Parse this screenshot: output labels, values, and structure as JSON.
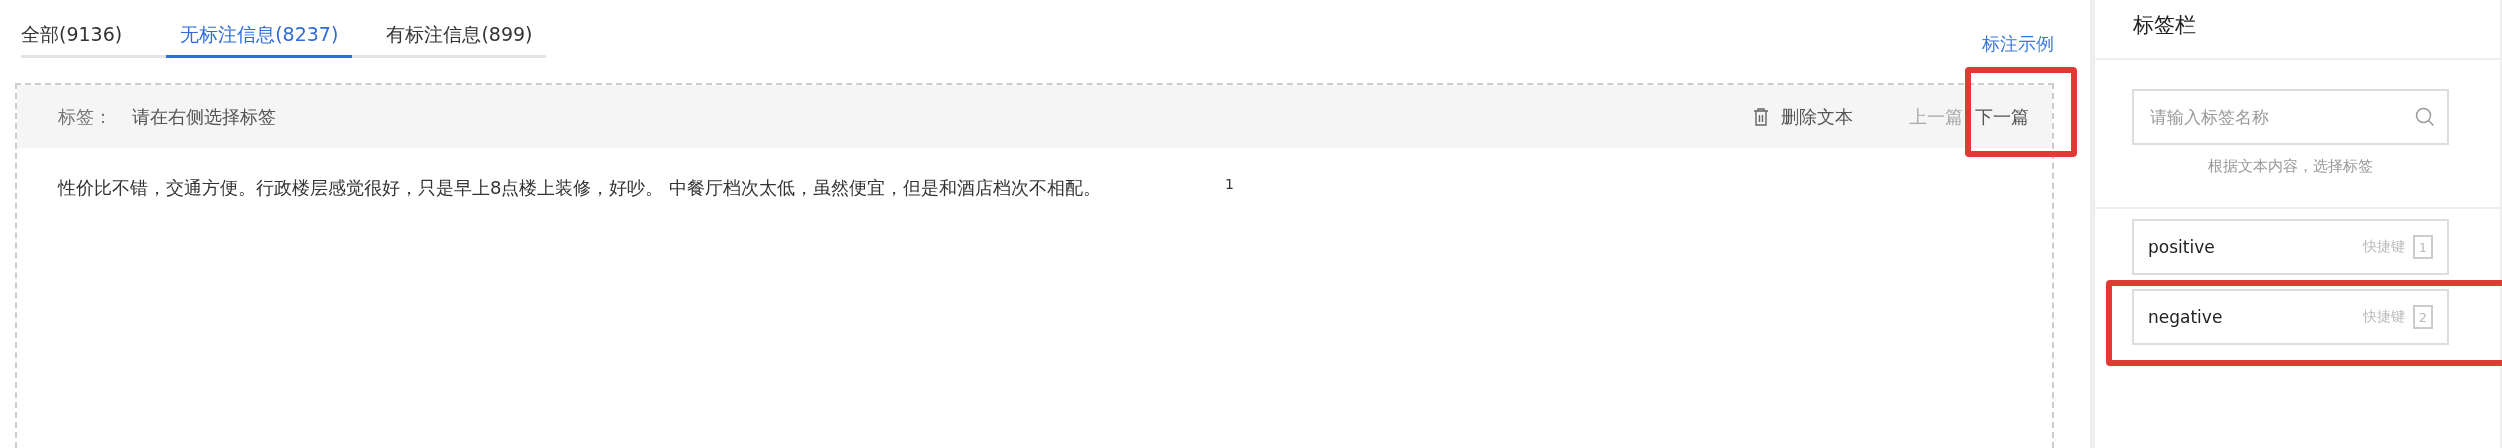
{
  "tabs": [
    {
      "label": "全部(9136)",
      "selected": false
    },
    {
      "label": "无标注信息(8237)",
      "selected": true
    },
    {
      "label": "有标注信息(899)",
      "selected": false
    }
  ],
  "example_link": "标注示例",
  "toolbar": {
    "label_caption": "标签：",
    "label_value": "请在右侧选择标签",
    "delete": "删除文本",
    "prev": {
      "label": "上一篇",
      "disabled": true,
      "highlighted": false
    },
    "next": {
      "label": "下一篇",
      "disabled": false,
      "highlighted": true
    }
  },
  "document": {
    "text": "性价比不错，交通方便。行政楼层感觉很好，只是早上8点楼上装修，好吵。  中餐厅档次太低，虽然便宜，但是和酒店档次不相配。",
    "count": "1"
  },
  "sidebar": {
    "title": "标签栏",
    "search": {
      "placeholder": "请输入标签名称"
    },
    "hint": "根据文本内容，选择标签",
    "labels": [
      {
        "name": "positive",
        "shortcut_caption": "快捷键",
        "key": "1",
        "highlighted": false
      },
      {
        "name": "negative",
        "shortcut_caption": "快捷键",
        "key": "2",
        "highlighted": true
      }
    ]
  }
}
